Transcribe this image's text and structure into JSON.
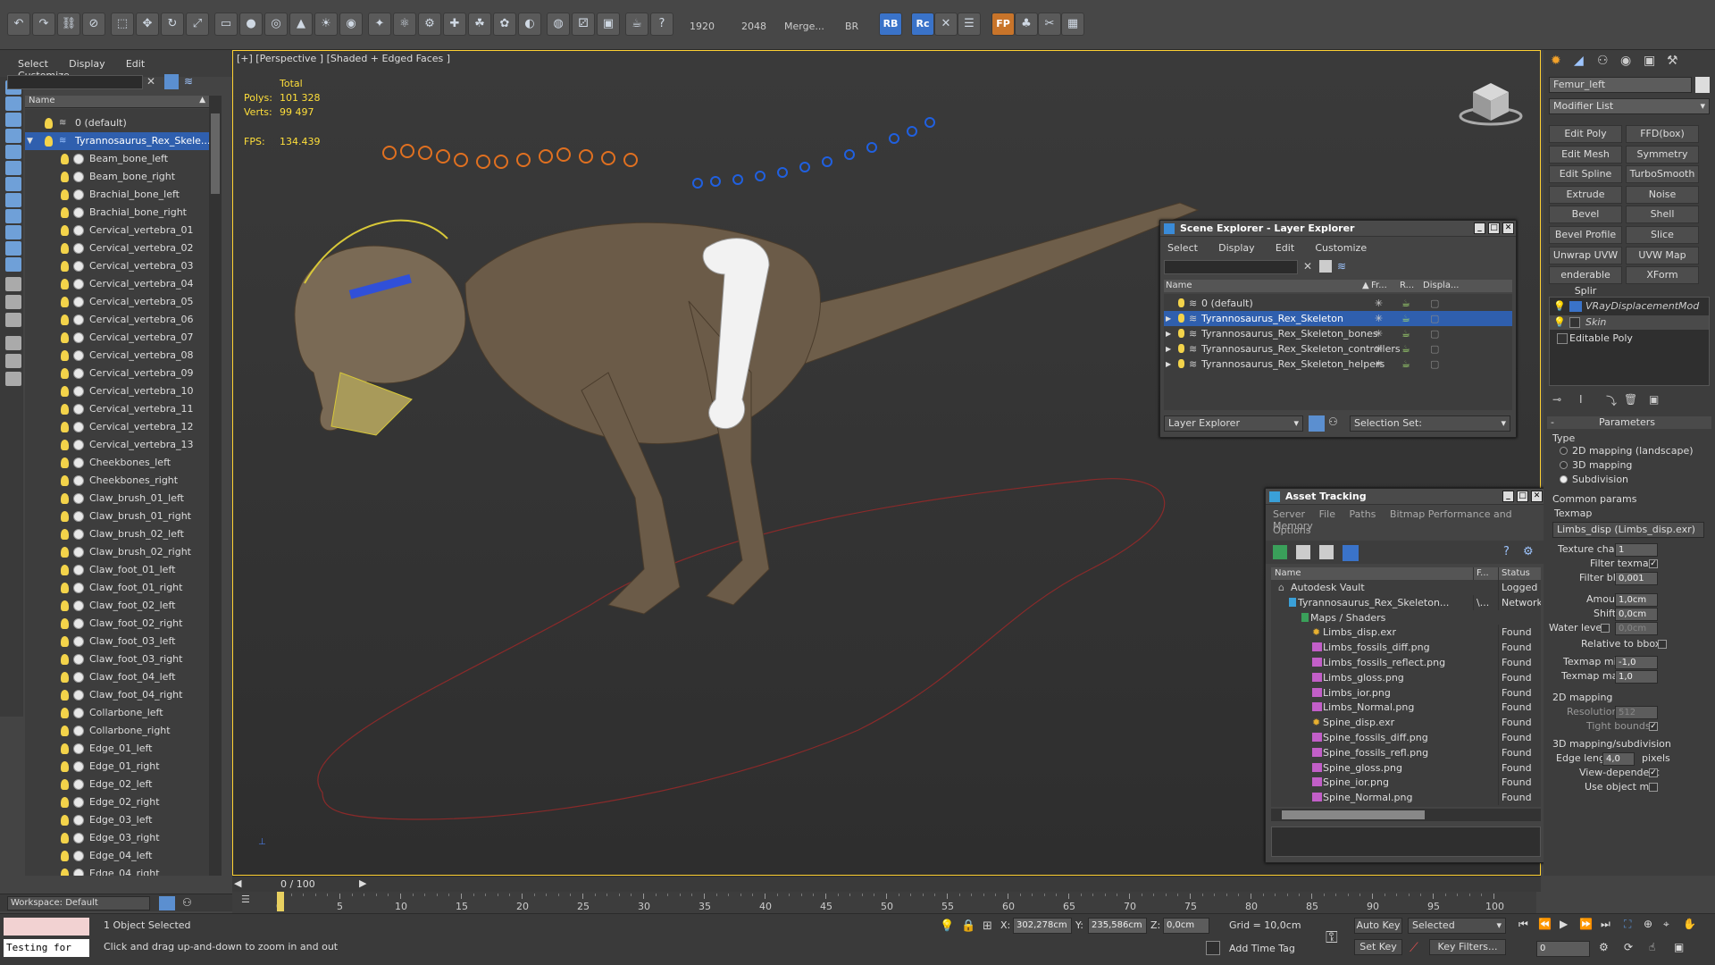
{
  "toolbar": {
    "values": [
      "1920",
      "2048",
      "Merge...",
      "BR"
    ],
    "buttons": [
      "RB",
      "Rc",
      "FP"
    ]
  },
  "scene_panel": {
    "menu": [
      "Select",
      "Display",
      "Edit",
      "Customize"
    ],
    "header_name": "Name",
    "layers": [
      "0 (default)",
      "Tyrannosaurus_Rex_Skele..."
    ],
    "bones": [
      "Beam_bone_left",
      "Beam_bone_right",
      "Brachial_bone_left",
      "Brachial_bone_right",
      "Cervical_vertebra_01",
      "Cervical_vertebra_02",
      "Cervical_vertebra_03",
      "Cervical_vertebra_04",
      "Cervical_vertebra_05",
      "Cervical_vertebra_06",
      "Cervical_vertebra_07",
      "Cervical_vertebra_08",
      "Cervical_vertebra_09",
      "Cervical_vertebra_10",
      "Cervical_vertebra_11",
      "Cervical_vertebra_12",
      "Cervical_vertebra_13",
      "Cheekbones_left",
      "Cheekbones_right",
      "Claw_brush_01_left",
      "Claw_brush_01_right",
      "Claw_brush_02_left",
      "Claw_brush_02_right",
      "Claw_foot_01_left",
      "Claw_foot_01_right",
      "Claw_foot_02_left",
      "Claw_foot_02_right",
      "Claw_foot_03_left",
      "Claw_foot_03_right",
      "Claw_foot_04_left",
      "Claw_foot_04_right",
      "Collarbone_left",
      "Collarbone_right",
      "Edge_01_left",
      "Edge_01_right",
      "Edge_02_left",
      "Edge_02_right",
      "Edge_03_left",
      "Edge_03_right",
      "Edge_04_left",
      "Edge_04_right"
    ],
    "workspace": "Workspace: Default"
  },
  "viewport": {
    "label": "[+] [Perspective ] [Shaded + Edged Faces ]",
    "stats_total": "Total",
    "polys_label": "Polys:",
    "polys_value": "101 328",
    "verts_label": "Verts:",
    "verts_value": "99 497",
    "fps_label": "FPS:",
    "fps_value": "134.439"
  },
  "layer_explorer": {
    "title": "Scene Explorer - Layer Explorer",
    "menu": [
      "Select",
      "Display",
      "Edit",
      "Customize"
    ],
    "columns": [
      "Name",
      "Fr...",
      "R...",
      "Displa..."
    ],
    "rows": [
      "0 (default)",
      "Tyrannosaurus_Rex_Skeleton",
      "Tyrannosaurus_Rex_Skeleton_bones",
      "Tyrannosaurus_Rex_Skeleton_controllers",
      "Tyrannosaurus_Rex_Skeleton_helpers"
    ],
    "footer_dropdown": "Layer Explorer",
    "selection_set": "Selection Set:"
  },
  "asset_tracking": {
    "title": "Asset Tracking",
    "menu": [
      "Server",
      "File",
      "Paths",
      "Bitmap Performance and Memory"
    ],
    "menu2": "Options",
    "columns": [
      "Name",
      "F...",
      "Status"
    ],
    "rows": [
      {
        "name": "Autodesk Vault",
        "f": "",
        "status": "Logged Ou"
      },
      {
        "name": "Tyrannosaurus_Rex_Skeleton...",
        "f": "\\...",
        "status": "Network P"
      },
      {
        "name": "Maps / Shaders",
        "f": "",
        "status": ""
      },
      {
        "name": "Limbs_disp.exr",
        "f": "",
        "status": "Found"
      },
      {
        "name": "Limbs_fossils_diff.png",
        "f": "",
        "status": "Found"
      },
      {
        "name": "Limbs_fossils_reflect.png",
        "f": "",
        "status": "Found"
      },
      {
        "name": "Limbs_gloss.png",
        "f": "",
        "status": "Found"
      },
      {
        "name": "Limbs_ior.png",
        "f": "",
        "status": "Found"
      },
      {
        "name": "Limbs_Normal.png",
        "f": "",
        "status": "Found"
      },
      {
        "name": "Spine_disp.exr",
        "f": "",
        "status": "Found"
      },
      {
        "name": "Spine_fossils_diff.png",
        "f": "",
        "status": "Found"
      },
      {
        "name": "Spine_fossils_refl.png",
        "f": "",
        "status": "Found"
      },
      {
        "name": "Spine_gloss.png",
        "f": "",
        "status": "Found"
      },
      {
        "name": "Spine_ior.png",
        "f": "",
        "status": "Found"
      },
      {
        "name": "Spine_Normal.png",
        "f": "",
        "status": "Found"
      }
    ]
  },
  "command_panel": {
    "object_name": "Femur_left",
    "modifier_list": "Modifier List",
    "modifier_buttons": [
      "Edit Poly",
      "FFD(box)",
      "Edit Mesh",
      "Symmetry",
      "Edit Spline",
      "TurboSmooth",
      "Extrude",
      "Noise",
      "Bevel",
      "Shell",
      "Bevel Profile",
      "Slice",
      "Unwrap UVW",
      "UVW Map",
      "enderable Splir",
      "XForm"
    ],
    "stack": [
      "VRayDisplacementMod",
      "Skin",
      "Editable Poly"
    ],
    "parameters": "Parameters",
    "type_label": "Type",
    "type_options": [
      "2D mapping (landscape)",
      "3D mapping",
      "Subdivision"
    ],
    "common_params": "Common params",
    "texmap_label": "Texmap",
    "texmap_value": "Limbs_disp (Limbs_disp.exr)",
    "texture_chan_label": "Texture chan",
    "texture_chan_value": "1",
    "filter_texmap": "Filter texmap",
    "filter_blur_label": "Filter blur",
    "filter_blur_value": "0,001",
    "amount_label": "Amount",
    "amount_value": "1,0cm",
    "shift_label": "Shift",
    "shift_value": "0,0cm",
    "water_level_label": "Water level",
    "water_level_value": "0,0cm",
    "relative_to_bbox": "Relative to bbox",
    "texmap_min_label": "Texmap min",
    "texmap_min_value": "-1,0",
    "texmap_max_label": "Texmap max",
    "texmap_max_value": "1,0",
    "mapping_2d": "2D mapping",
    "resolution_label": "Resolution",
    "resolution_value": "512",
    "tight_bounds": "Tight bounds",
    "mapping_3d": "3D mapping/subdivision",
    "edge_length_label": "Edge length",
    "edge_length_value": "4,0",
    "edge_length_unit": "pixels",
    "view_dependent": "View-dependent",
    "use_object_mtl": "Use object mtl"
  },
  "timeline": {
    "frame_counter": "0 / 100",
    "ticks": [
      "0",
      "5",
      "10",
      "15",
      "20",
      "25",
      "30",
      "35",
      "40",
      "45",
      "50",
      "55",
      "60",
      "65",
      "70",
      "75",
      "80",
      "85",
      "90",
      "95",
      "100"
    ]
  },
  "status_bar": {
    "maxscript": "Testing for",
    "selected": "1 Object Selected",
    "prompt": "Click and drag up-and-down to zoom in and out",
    "x_label": "X:",
    "x_value": "302,278cm",
    "y_label": "Y:",
    "y_value": "235,586cm",
    "z_label": "Z:",
    "z_value": "0,0cm",
    "grid": "Grid = 10,0cm",
    "add_time_tag": "Add Time Tag",
    "auto_key": "Auto Key",
    "set_key": "Set Key",
    "selected_dropdown": "Selected",
    "key_filters": "Key Filters...",
    "frame_field": "0"
  }
}
